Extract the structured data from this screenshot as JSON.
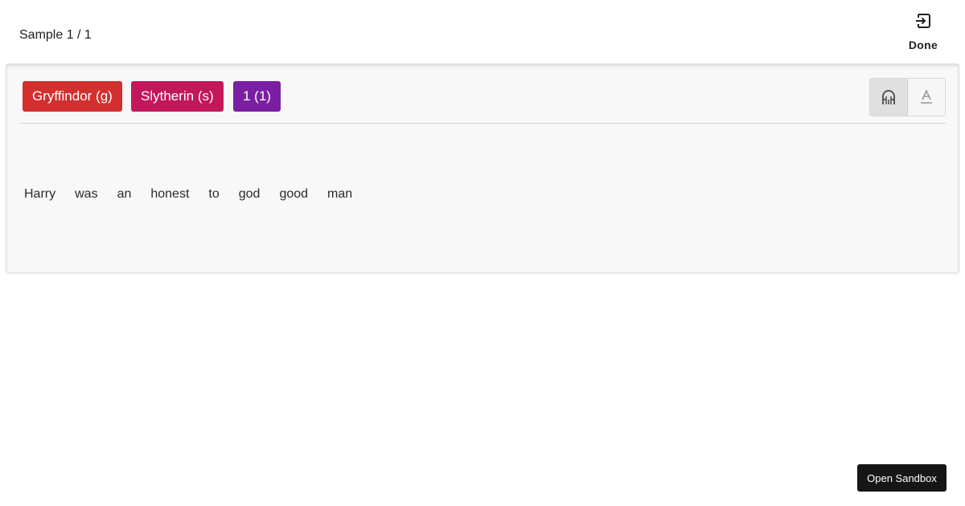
{
  "header": {
    "sample_counter": "Sample 1 / 1",
    "done_label": "Done",
    "done_icon": "exit-to-app-icon"
  },
  "labels": [
    {
      "text": "Gryffindor (g)",
      "color": "#d32f2f"
    },
    {
      "text": "Slytherin (s)",
      "color": "#c2185b"
    },
    {
      "text": "1 (1)",
      "color": "#7b1fa2"
    }
  ],
  "mode_toggle": {
    "options": [
      {
        "icon": "magnet-icon",
        "active": true
      },
      {
        "icon": "text-underline-icon",
        "active": false
      }
    ]
  },
  "tokens": [
    "Harry",
    "was",
    "an",
    "honest",
    "to",
    "god",
    "good",
    "man"
  ],
  "footer": {
    "sandbox_label": "Open Sandbox"
  }
}
